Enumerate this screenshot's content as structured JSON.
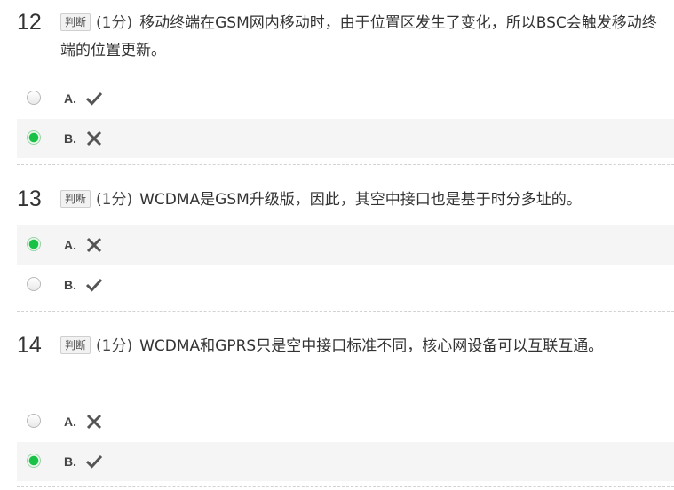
{
  "questions": [
    {
      "number": "12",
      "tag": "判断",
      "score": "(1分)",
      "text": "移动终端在GSM网内移动时，由于位置区发生了变化，所以BSC会触发移动终端的位置更新。",
      "options": [
        {
          "label": "A.",
          "icon": "check-icon",
          "selected": false
        },
        {
          "label": "B.",
          "icon": "cross-icon",
          "selected": true
        }
      ]
    },
    {
      "number": "13",
      "tag": "判断",
      "score": "(1分)",
      "text": "WCDMA是GSM升级版，因此，其空中接口也是基于时分多址的。",
      "options": [
        {
          "label": "A.",
          "icon": "cross-icon",
          "selected": true
        },
        {
          "label": "B.",
          "icon": "check-icon",
          "selected": false
        }
      ]
    },
    {
      "number": "14",
      "tag": "判断",
      "score": "(1分)",
      "text": "WCDMA和GPRS只是空中接口标准不同，核心网设备可以互联互通。",
      "options": [
        {
          "label": "A.",
          "icon": "cross-icon",
          "selected": false
        },
        {
          "label": "B.",
          "icon": "check-icon",
          "selected": true
        }
      ]
    }
  ],
  "colors": {
    "selected_radio": "#19c246",
    "selected_row_bg": "#f5f5f5",
    "mark": "#555555"
  }
}
